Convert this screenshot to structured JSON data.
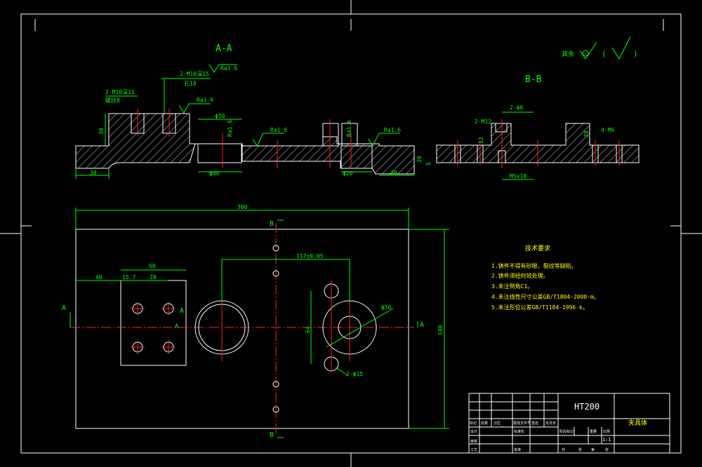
{
  "section_aa": {
    "title": "A-A",
    "roughness": "Ra1.6",
    "dims": {
      "left_30": "30",
      "right_30": "30",
      "h30": "30",
      "phi50": "ϕ50",
      "phi40": "ϕ40",
      "phi20": "ϕ20",
      "thread1": "2-M10深15",
      "thread1b": "螺纹8",
      "thread2": "2-M10深15",
      "thread2b": "孔18",
      "tol": "+0.025"
    }
  },
  "section_bb": {
    "title": "B-B",
    "dims": {
      "m12": "2-M12",
      "phi6": "2-ϕ6",
      "h12": "12",
      "h20a": "20",
      "h5": "5",
      "h20b": "20",
      "m6": "4-M6",
      "m5x18": "M5x18"
    }
  },
  "surface": {
    "label": "其余",
    "paren_open": "(",
    "paren_close": ")"
  },
  "plan": {
    "dims": {
      "len300": "300",
      "w40": "40",
      "w60": "60",
      "w157": "15.7",
      "w28": "28",
      "c117": "117±0.05",
      "h64": "64",
      "h180": "180",
      "phi50": "ϕ50",
      "phi15": "2-ϕ15"
    },
    "markers": {
      "a_left": "A",
      "a_right": "A",
      "a_mid": "A",
      "a_inner": "A",
      "b_top": "B",
      "b_bottom": "B"
    }
  },
  "tech_req": {
    "title": "技术要求",
    "items": [
      "1.铸件不得有砂眼、裂纹等缺陷。",
      "2.铸件须经时效处理。",
      "3.未注倒角C1。",
      "4.未注线性尺寸公差GB/T1804-2000-m。",
      "5.未注形位公差GB/T1184-1996-k。"
    ]
  },
  "title_block": {
    "material": "HT200",
    "name": "夹具体",
    "scale": "1:1",
    "row1": [
      "标记",
      "处数",
      "分区",
      "更改文件号",
      "签名",
      "年月日"
    ],
    "row2": [
      "设计",
      "标准化",
      "阶段标记",
      "重量",
      "比例"
    ],
    "row3": [
      "审核",
      "工艺",
      "批准",
      "共",
      "张",
      "第",
      "张"
    ]
  }
}
